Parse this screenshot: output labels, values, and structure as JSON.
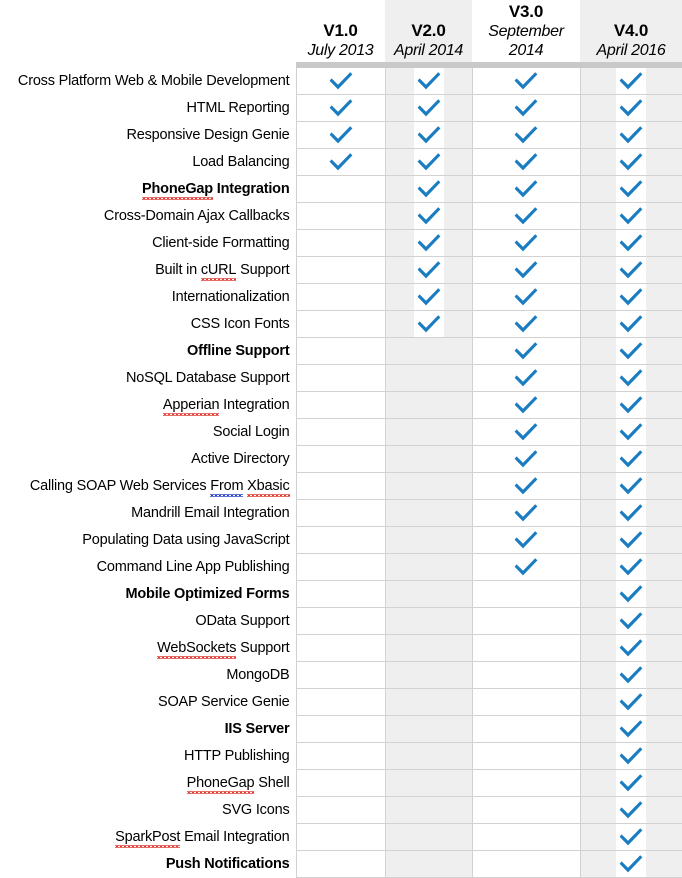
{
  "table": {
    "label_column_header": "",
    "columns": [
      {
        "version": "V1.0",
        "date": "July 2013",
        "shaded": false
      },
      {
        "version": "V2.0",
        "date": "April 2014",
        "shaded": true
      },
      {
        "version": "V3.0",
        "date": "September 2014",
        "shaded": false
      },
      {
        "version": "V4.0",
        "date": "April 2016",
        "shaded": true
      }
    ],
    "check_icon": "blue-checkmark-icon",
    "check_color": "#1a7cc1",
    "shaded_column_color": "#efefef",
    "grid_line_color": "#d2d2d2",
    "rows": [
      {
        "feature": "Cross Platform Web & Mobile Development",
        "bold": false,
        "checks": [
          true,
          true,
          true,
          true
        ]
      },
      {
        "feature": "HTML Reporting",
        "bold": false,
        "checks": [
          true,
          true,
          true,
          true
        ]
      },
      {
        "feature": "Responsive Design Genie",
        "bold": false,
        "checks": [
          true,
          true,
          true,
          true
        ]
      },
      {
        "feature": "Load Balancing",
        "bold": false,
        "checks": [
          true,
          true,
          true,
          true
        ]
      },
      {
        "feature": "PhoneGap Integration",
        "bold": true,
        "checks": [
          false,
          true,
          true,
          true
        ],
        "misspelled": [
          "PhoneGap"
        ]
      },
      {
        "feature": "Cross-Domain Ajax Callbacks",
        "bold": false,
        "checks": [
          false,
          true,
          true,
          true
        ]
      },
      {
        "feature": "Client-side Formatting",
        "bold": false,
        "checks": [
          false,
          true,
          true,
          true
        ]
      },
      {
        "feature": "Built in cURL Support",
        "bold": false,
        "checks": [
          false,
          true,
          true,
          true
        ],
        "misspelled": [
          "cURL"
        ]
      },
      {
        "feature": "Internationalization",
        "bold": false,
        "checks": [
          false,
          true,
          true,
          true
        ]
      },
      {
        "feature": "CSS Icon Fonts",
        "bold": false,
        "checks": [
          false,
          true,
          true,
          true
        ]
      },
      {
        "feature": "Offline Support",
        "bold": true,
        "checks": [
          false,
          false,
          true,
          true
        ]
      },
      {
        "feature": "NoSQL Database Support",
        "bold": false,
        "checks": [
          false,
          false,
          true,
          true
        ]
      },
      {
        "feature": "Apperian Integration",
        "bold": false,
        "checks": [
          false,
          false,
          true,
          true
        ],
        "misspelled": [
          "Apperian"
        ]
      },
      {
        "feature": "Social Login",
        "bold": false,
        "checks": [
          false,
          false,
          true,
          true
        ]
      },
      {
        "feature": "Active Directory",
        "bold": false,
        "checks": [
          false,
          false,
          true,
          true
        ]
      },
      {
        "feature": "Calling SOAP Web Services From Xbasic",
        "bold": false,
        "checks": [
          false,
          false,
          true,
          true
        ],
        "misspelled": [
          "Xbasic"
        ],
        "grammar": [
          "From"
        ]
      },
      {
        "feature": "Mandrill Email Integration",
        "bold": false,
        "checks": [
          false,
          false,
          true,
          true
        ]
      },
      {
        "feature": "Populating Data using JavaScript",
        "bold": false,
        "checks": [
          false,
          false,
          true,
          true
        ]
      },
      {
        "feature": "Command Line App Publishing",
        "bold": false,
        "checks": [
          false,
          false,
          true,
          true
        ]
      },
      {
        "feature": "Mobile Optimized Forms",
        "bold": true,
        "checks": [
          false,
          false,
          false,
          true
        ]
      },
      {
        "feature": "OData Support",
        "bold": false,
        "checks": [
          false,
          false,
          false,
          true
        ]
      },
      {
        "feature": "WebSockets Support",
        "bold": false,
        "checks": [
          false,
          false,
          false,
          true
        ],
        "misspelled": [
          "WebSockets"
        ]
      },
      {
        "feature": "MongoDB",
        "bold": false,
        "checks": [
          false,
          false,
          false,
          true
        ]
      },
      {
        "feature": "SOAP Service Genie",
        "bold": false,
        "checks": [
          false,
          false,
          false,
          true
        ]
      },
      {
        "feature": "IIS Server",
        "bold": true,
        "checks": [
          false,
          false,
          false,
          true
        ]
      },
      {
        "feature": "HTTP Publishing",
        "bold": false,
        "checks": [
          false,
          false,
          false,
          true
        ]
      },
      {
        "feature": "PhoneGap Shell",
        "bold": false,
        "checks": [
          false,
          false,
          false,
          true
        ],
        "misspelled": [
          "PhoneGap"
        ]
      },
      {
        "feature": "SVG Icons",
        "bold": false,
        "checks": [
          false,
          false,
          false,
          true
        ]
      },
      {
        "feature": "SparkPost Email Integration",
        "bold": false,
        "checks": [
          false,
          false,
          false,
          true
        ],
        "misspelled": [
          "SparkPost"
        ]
      },
      {
        "feature": "Push Notifications",
        "bold": true,
        "checks": [
          false,
          false,
          false,
          true
        ]
      }
    ]
  }
}
